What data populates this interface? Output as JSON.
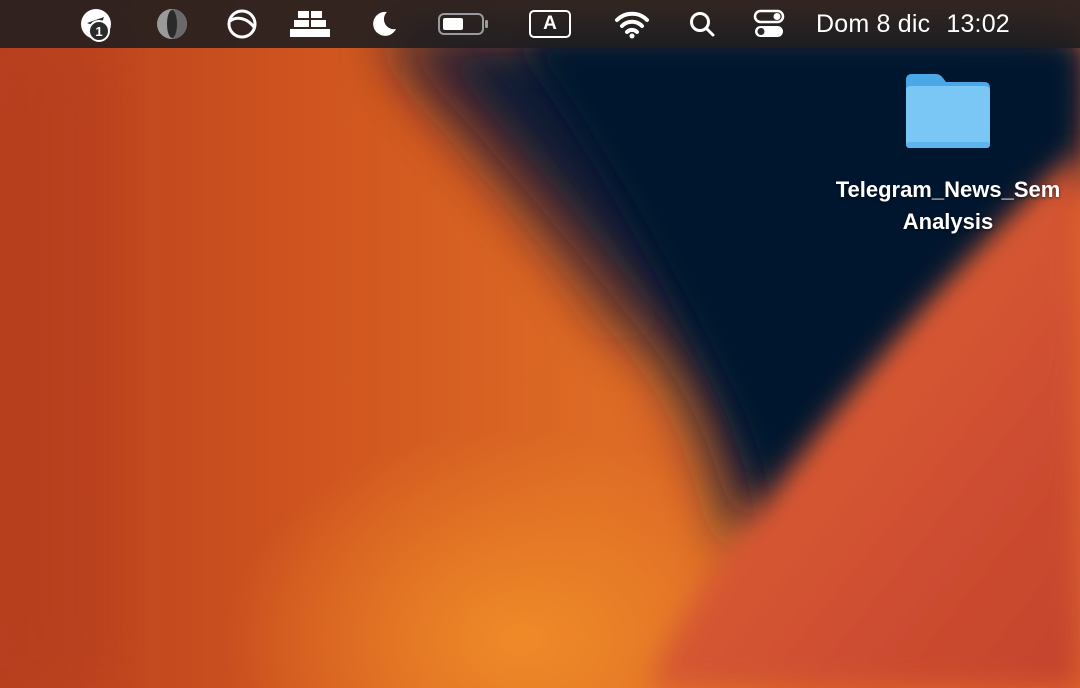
{
  "menubar": {
    "telegram": {
      "icon": "telegram-paper-plane-icon",
      "badge_count": "1"
    },
    "icons": [
      "contrast-circle-icon",
      "circle-slash-icon",
      "stacked-bars-icon",
      "moon-icon",
      "battery-icon",
      "wifi-icon",
      "search-icon",
      "control-center-icon"
    ],
    "input_source": "A",
    "date": "Dom 8 dic",
    "time": "13:02"
  },
  "desktop": {
    "folder": {
      "icon": "folder-icon",
      "label": "Telegram_News_SemAnalysis",
      "color": "#7ac7f5"
    }
  },
  "colors": {
    "menubar_bg": "#1e1e20",
    "wallpaper_orange": "#dd6a25",
    "wallpaper_navy": "#0a1e36"
  }
}
